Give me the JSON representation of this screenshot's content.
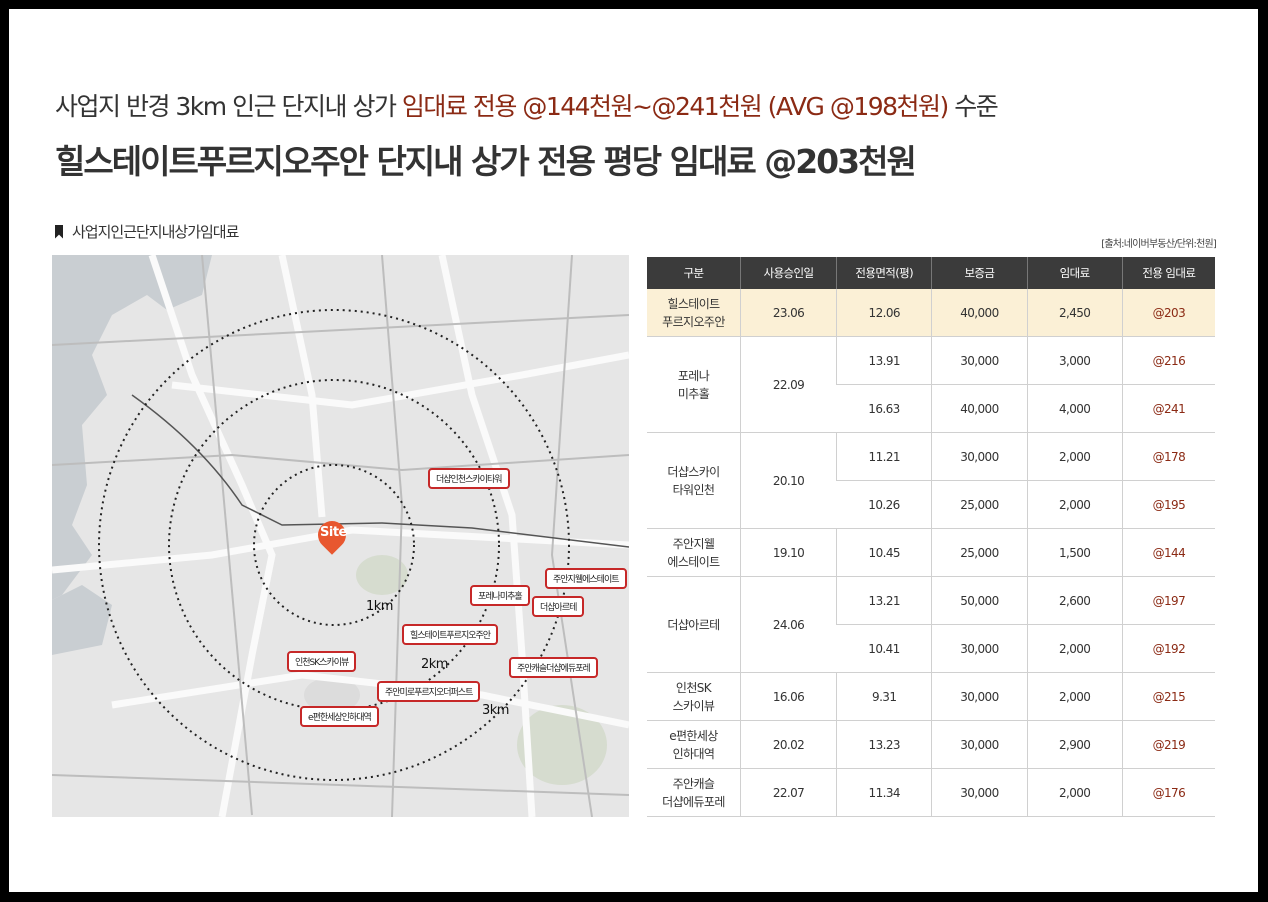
{
  "headline": {
    "line1_prefix": "사업지 반경 3km 인근 단지내 상가 ",
    "line1_highlight": "임대료 전용 @144천원~@241천원 (AVG @198천원)",
    "line1_suffix": " 수준",
    "line2": "힐스테이트푸르지오주안 단지내 상가 전용 평당 임대료 @203천원"
  },
  "section_title": "사업지인근단지내상가임대료",
  "source": "[출처:네이버부동산/단위:천원]",
  "map": {
    "site_label": "Site",
    "rings": [
      "1km",
      "2km",
      "3km"
    ],
    "callouts": [
      "더샵인천스카이타워",
      "주안지웰에스테이트",
      "포레나미추홀",
      "더샵아르테",
      "힐스테이트푸르지오주안",
      "주안캐슬더샵에듀포레",
      "인천SK스카이뷰",
      "주안미로푸르지오더퍼스트",
      "e편한세상인하대역"
    ]
  },
  "table": {
    "headers": [
      "구분",
      "사용승인일",
      "전용면적(평)",
      "보증금",
      "임대료",
      "전용 임대료"
    ],
    "groups": [
      {
        "name_line1": "힐스테이트",
        "name_line2": "푸르지오주안",
        "date": "23.06",
        "highlight": true,
        "rows": [
          {
            "area": "12.06",
            "deposit": "40,000",
            "rent": "2,450",
            "unit_rent": "@203"
          }
        ]
      },
      {
        "name_line1": "포레나",
        "name_line2": "미추홀",
        "date": "22.09",
        "rows": [
          {
            "area": "13.91",
            "deposit": "30,000",
            "rent": "3,000",
            "unit_rent": "@216"
          },
          {
            "area": "16.63",
            "deposit": "40,000",
            "rent": "4,000",
            "unit_rent": "@241"
          }
        ]
      },
      {
        "name_line1": "더샵스카이",
        "name_line2": "타워인천",
        "date": "20.10",
        "rows": [
          {
            "area": "11.21",
            "deposit": "30,000",
            "rent": "2,000",
            "unit_rent": "@178"
          },
          {
            "area": "10.26",
            "deposit": "25,000",
            "rent": "2,000",
            "unit_rent": "@195"
          }
        ]
      },
      {
        "name_line1": "주안지웰",
        "name_line2": "에스테이트",
        "date": "19.10",
        "rows": [
          {
            "area": "10.45",
            "deposit": "25,000",
            "rent": "1,500",
            "unit_rent": "@144"
          }
        ]
      },
      {
        "name_line1": "더샵아르테",
        "name_line2": "",
        "date": "24.06",
        "rows": [
          {
            "area": "13.21",
            "deposit": "50,000",
            "rent": "2,600",
            "unit_rent": "@197"
          },
          {
            "area": "10.41",
            "deposit": "30,000",
            "rent": "2,000",
            "unit_rent": "@192"
          }
        ]
      },
      {
        "name_line1": "인천SK",
        "name_line2": "스카이뷰",
        "date": "16.06",
        "rows": [
          {
            "area": "9.31",
            "deposit": "30,000",
            "rent": "2,000",
            "unit_rent": "@215"
          }
        ]
      },
      {
        "name_line1": "e편한세상",
        "name_line2": "인하대역",
        "date": "20.02",
        "rows": [
          {
            "area": "13.23",
            "deposit": "30,000",
            "rent": "2,900",
            "unit_rent": "@219"
          }
        ]
      },
      {
        "name_line1": "주안캐슬",
        "name_line2": "더샵에듀포레",
        "date": "22.07",
        "rows": [
          {
            "area": "11.34",
            "deposit": "30,000",
            "rent": "2,000",
            "unit_rent": "@176"
          }
        ]
      }
    ]
  },
  "colors": {
    "accent": "#8b2a14",
    "highlight_row": "#fbf0d6",
    "header_bg": "#3b3b3b",
    "callout_border": "#c62828",
    "site_pin": "#e8572f"
  }
}
